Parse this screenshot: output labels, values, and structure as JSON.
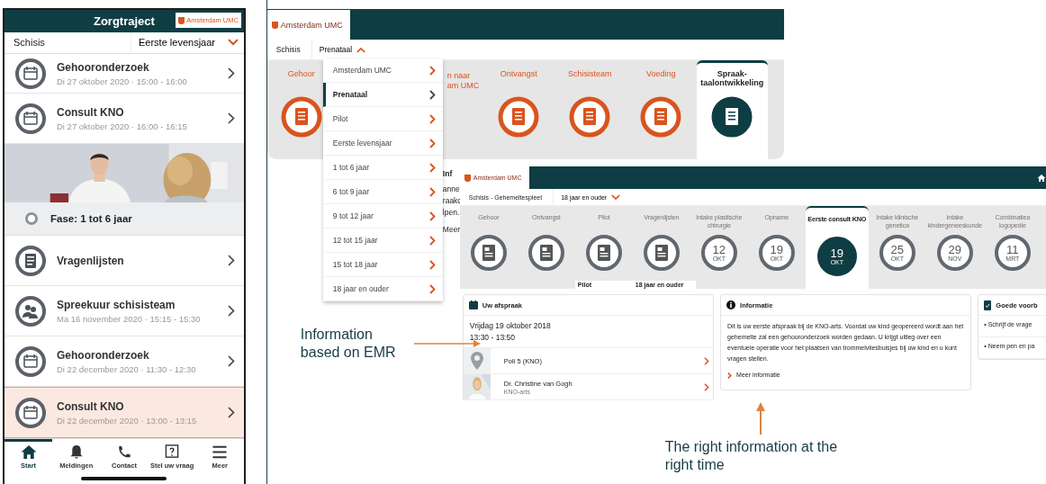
{
  "phone": {
    "title": "Zorgtraject",
    "logo": "Amsterdam UMC",
    "condition": "Schisis",
    "phase": "Eerste levensjaar",
    "phase_expanded": false,
    "timeline": [
      {
        "kind": "appointment",
        "title": "Gehooronderzoek",
        "subtitle": "Di 27 oktober 2020 · 15:00 - 16:00",
        "selected": false
      },
      {
        "kind": "appointment",
        "title": "Consult KNO",
        "subtitle": "Di 27 oktober 2020 · 16:00 - 16:15",
        "selected": false
      },
      {
        "kind": "picture"
      },
      {
        "kind": "phase",
        "title": "Fase: 1 tot 6 jaar"
      },
      {
        "kind": "questionnaire",
        "title": "Vragenlijsten",
        "selected": false
      },
      {
        "kind": "team",
        "title": "Spreekuur schisisteam",
        "subtitle": "Ma 16 november 2020 · 15:15 - 15:30",
        "selected": false
      },
      {
        "kind": "appointment",
        "title": "Gehooronderzoek",
        "subtitle": "Di 22 december 2020 · 11:30 - 12:30",
        "selected": false
      },
      {
        "kind": "appointment",
        "title": "Consult KNO",
        "subtitle": "Di 22 december 2020 · 13:00 - 13:15",
        "selected": true
      }
    ],
    "tabs": [
      {
        "label": "Start",
        "selected": true
      },
      {
        "label": "Meldingen",
        "selected": false
      },
      {
        "label": "Contact",
        "selected": false
      },
      {
        "label": "Stel uw vraag",
        "selected": false
      },
      {
        "label": "Meer",
        "selected": false
      }
    ]
  },
  "back_window": {
    "logo": "Amsterdam UMC",
    "condition": "Schisis",
    "phase": "Prenataal",
    "phase_expanded": true,
    "steps": [
      {
        "kind": "step",
        "label": "Gehoor",
        "selected": false
      },
      {
        "kind": "cut",
        "label": "n naar am UMC",
        "selected": false
      },
      {
        "kind": "step",
        "label": "Ontvangst",
        "selected": false
      },
      {
        "kind": "step",
        "label": "Schisisteam",
        "selected": false
      },
      {
        "kind": "step",
        "label": "Voeding",
        "selected": false
      },
      {
        "kind": "step",
        "label": "Spraak-taalontwikkeling",
        "selected": true
      }
    ],
    "menu": [
      {
        "label": "Amsterdam UMC",
        "selected": false
      },
      {
        "label": "Prenataal",
        "selected": true
      },
      {
        "label": "Pilot",
        "selected": false
      },
      {
        "label": "Eerste levensjaar",
        "selected": false
      },
      {
        "label": "1 tot 6 jaar",
        "selected": false
      },
      {
        "label": "6 tot 9 jaar",
        "selected": false
      },
      {
        "label": "9 tot 12 jaar",
        "selected": false
      },
      {
        "label": "12 tot 15 jaar",
        "selected": false
      },
      {
        "label": "15 tot 18 jaar",
        "selected": false
      },
      {
        "label": "18 jaar en ouder",
        "selected": false
      }
    ],
    "info_heading": "Inf",
    "info_lines": [
      "anne",
      "raakc",
      "lpen."
    ],
    "info_link": "Meer"
  },
  "front_window": {
    "logo": "Amsterdam UMC",
    "condition": "Schisis - Gehemeltespleet",
    "phase": "18 jaar en ouder",
    "phase_expanded": false,
    "steps": [
      {
        "label": "Gehoor",
        "selected": false
      },
      {
        "label": "Ontvangst",
        "selected": false
      },
      {
        "label": "Pilot",
        "phase_label": "Pilot",
        "selected": false
      },
      {
        "label": "Vragenlijsten",
        "phase_label": "18 jaar en ouder",
        "selected": false
      },
      {
        "label": "Intake plastische chirurgie",
        "day": "12",
        "month": "OKT",
        "selected": false
      },
      {
        "label": "Opname",
        "day": "19",
        "month": "OKT",
        "selected": false
      },
      {
        "label": "Eerste consult KNO",
        "day": "19",
        "month": "OKT",
        "selected": true
      },
      {
        "label": "Intake klinische genetica",
        "day": "25",
        "month": "OKT",
        "selected": false
      },
      {
        "label": "Intake kindergeneeskunde",
        "day": "29",
        "month": "NOV",
        "selected": false
      },
      {
        "label": "Combinatiea logopedie",
        "day": "11",
        "month": "MRT",
        "selected": false
      }
    ],
    "appointment": {
      "title": "Uw afspraak",
      "date": "Vrijdag 19 oktober 2018",
      "time": "13:30 - 13:50",
      "location": "Poli 5 (KNO)",
      "doctor": "Dr. Christine van Gogh",
      "role": "KNO-arts"
    },
    "info": {
      "title": "Informatie",
      "text": "Dit is uw eerste afspraak bij de KNO-arts. Voordat uw kind geopereerd wordt aan het gehemelte zal een gehooronderzoek worden gedaan. U krijgt uitleg over een eventuele operatie voor het plaatsen van trommelvliesbuisjes bij uw kind en u kunt vragen stellen.",
      "link": "Meer informatie"
    },
    "tips": {
      "title": "Goede voorb",
      "items": [
        "• Schrijf de vrage",
        "• Neem pen en pa"
      ]
    }
  },
  "annotations": [
    {
      "text": "Information based on EMR"
    },
    {
      "text": "The right information at the right time"
    }
  ]
}
